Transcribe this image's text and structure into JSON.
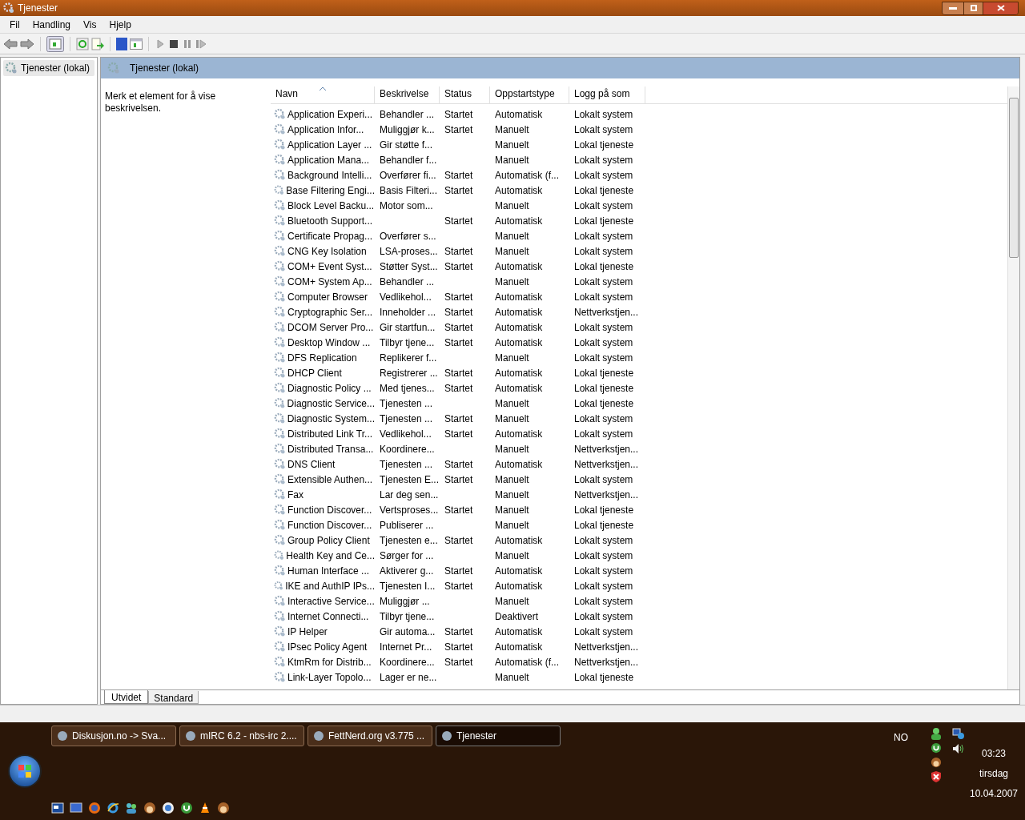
{
  "window": {
    "title": "Tjenester"
  },
  "menu": [
    "Fil",
    "Handling",
    "Vis",
    "Hjelp"
  ],
  "tree": [
    {
      "label": "Tjenester (lokal)",
      "selected": true
    }
  ],
  "header": {
    "title": "Tjenester (lokal)"
  },
  "description": "Merk et element for å vise beskrivelsen.",
  "table": {
    "columns": [
      {
        "label": "Navn",
        "sorted": true
      },
      {
        "label": "Beskrivelse",
        "sorted": false
      },
      {
        "label": "Status",
        "sorted": false
      },
      {
        "label": "Oppstartstype",
        "sorted": false
      },
      {
        "label": "Logg på som",
        "sorted": false
      }
    ],
    "rows": [
      {
        "name": "Application Experi...",
        "description": "Behandler ...",
        "status": "Startet",
        "startup": "Automatisk",
        "logon": "Lokalt system"
      },
      {
        "name": "Application Infor...",
        "description": "Muliggjør k...",
        "status": "Startet",
        "startup": "Manuelt",
        "logon": "Lokalt system"
      },
      {
        "name": "Application Layer ...",
        "description": "Gir støtte f...",
        "startup": "Manuelt",
        "logon": "Lokal tjeneste"
      },
      {
        "name": "Application Mana...",
        "description": "Behandler f...",
        "startup": "Manuelt",
        "logon": "Lokalt system"
      },
      {
        "name": "Background Intelli...",
        "description": "Overfører fi...",
        "status": "Startet",
        "startup": "Automatisk (f...",
        "logon": "Lokalt system"
      },
      {
        "name": "Base Filtering Engi...",
        "description": "Basis Filteri...",
        "status": "Startet",
        "startup": "Automatisk",
        "logon": "Lokal tjeneste"
      },
      {
        "name": "Block Level Backu...",
        "description": "Motor som...",
        "startup": "Manuelt",
        "logon": "Lokalt system"
      },
      {
        "name": "Bluetooth Support...",
        "status": "Startet",
        "startup": "Automatisk",
        "logon": "Lokal tjeneste"
      },
      {
        "name": "Certificate Propag...",
        "description": "Overfører s...",
        "startup": "Manuelt",
        "logon": "Lokalt system"
      },
      {
        "name": "CNG Key Isolation",
        "description": "LSA-proses...",
        "status": "Startet",
        "startup": "Manuelt",
        "logon": "Lokalt system"
      },
      {
        "name": "COM+ Event Syst...",
        "description": "Støtter Syst...",
        "status": "Startet",
        "startup": "Automatisk",
        "logon": "Lokal tjeneste"
      },
      {
        "name": "COM+ System Ap...",
        "description": "Behandler ...",
        "startup": "Manuelt",
        "logon": "Lokalt system"
      },
      {
        "name": "Computer Browser",
        "description": "Vedlikehol...",
        "status": "Startet",
        "startup": "Automatisk",
        "logon": "Lokalt system"
      },
      {
        "name": "Cryptographic Ser...",
        "description": "Inneholder ...",
        "status": "Startet",
        "startup": "Automatisk",
        "logon": "Nettverkstjen..."
      },
      {
        "name": "DCOM Server Pro...",
        "description": "Gir startfun...",
        "status": "Startet",
        "startup": "Automatisk",
        "logon": "Lokalt system"
      },
      {
        "name": "Desktop Window ...",
        "description": "Tilbyr tjene...",
        "status": "Startet",
        "startup": "Automatisk",
        "logon": "Lokalt system"
      },
      {
        "name": "DFS Replication",
        "description": "Replikerer f...",
        "startup": "Manuelt",
        "logon": "Lokalt system"
      },
      {
        "name": "DHCP Client",
        "description": "Registrerer ...",
        "status": "Startet",
        "startup": "Automatisk",
        "logon": "Lokal tjeneste"
      },
      {
        "name": "Diagnostic Policy ...",
        "description": "Med tjenes...",
        "status": "Startet",
        "startup": "Automatisk",
        "logon": "Lokal tjeneste"
      },
      {
        "name": "Diagnostic Service...",
        "description": "Tjenesten ...",
        "startup": "Manuelt",
        "logon": "Lokal tjeneste"
      },
      {
        "name": "Diagnostic System...",
        "description": "Tjenesten ...",
        "status": "Startet",
        "startup": "Manuelt",
        "logon": "Lokalt system"
      },
      {
        "name": "Distributed Link Tr...",
        "description": "Vedlikehol...",
        "status": "Startet",
        "startup": "Automatisk",
        "logon": "Lokalt system"
      },
      {
        "name": "Distributed Transa...",
        "description": "Koordinere...",
        "startup": "Manuelt",
        "logon": "Nettverkstjen..."
      },
      {
        "name": "DNS Client",
        "description": "Tjenesten ...",
        "status": "Startet",
        "startup": "Automatisk",
        "logon": "Nettverkstjen..."
      },
      {
        "name": "Extensible Authen...",
        "description": "Tjenesten E...",
        "status": "Startet",
        "startup": "Manuelt",
        "logon": "Lokalt system"
      },
      {
        "name": "Fax",
        "description": "Lar deg sen...",
        "startup": "Manuelt",
        "logon": "Nettverkstjen..."
      },
      {
        "name": "Function Discover...",
        "description": "Vertsproses...",
        "status": "Startet",
        "startup": "Manuelt",
        "logon": "Lokal tjeneste"
      },
      {
        "name": "Function Discover...",
        "description": "Publiserer ...",
        "startup": "Manuelt",
        "logon": "Lokal tjeneste"
      },
      {
        "name": "Group Policy Client",
        "description": "Tjenesten e...",
        "status": "Startet",
        "startup": "Automatisk",
        "logon": "Lokalt system"
      },
      {
        "name": "Health Key and Ce...",
        "description": "Sørger for ...",
        "startup": "Manuelt",
        "logon": "Lokalt system"
      },
      {
        "name": "Human Interface ...",
        "description": "Aktiverer g...",
        "status": "Startet",
        "startup": "Automatisk",
        "logon": "Lokalt system"
      },
      {
        "name": "IKE and AuthIP IPs...",
        "description": "Tjenesten I...",
        "status": "Startet",
        "startup": "Automatisk",
        "logon": "Lokalt system"
      },
      {
        "name": "Interactive Service...",
        "description": "Muliggjør ...",
        "startup": "Manuelt",
        "logon": "Lokalt system"
      },
      {
        "name": "Internet Connecti...",
        "description": "Tilbyr tjene...",
        "startup": "Deaktivert",
        "logon": "Lokalt system"
      },
      {
        "name": "IP Helper",
        "description": "Gir automa...",
        "status": "Startet",
        "startup": "Automatisk",
        "logon": "Lokalt system"
      },
      {
        "name": "IPsec Policy Agent",
        "description": "Internet Pr...",
        "status": "Startet",
        "startup": "Automatisk",
        "logon": "Nettverkstjen..."
      },
      {
        "name": "KtmRm for Distrib...",
        "description": "Koordinere...",
        "status": "Startet",
        "startup": "Automatisk (f...",
        "logon": "Nettverkstjen..."
      },
      {
        "name": "Link-Layer Topolo...",
        "description": "Lager er ne...",
        "startup": "Manuelt",
        "logon": "Lokal tjeneste"
      }
    ]
  },
  "view_tabs": [
    {
      "label": "Utvidet",
      "selected": true
    },
    {
      "label": "Standard",
      "selected": false
    }
  ],
  "taskbar": {
    "buttons": [
      {
        "label": "Diskusjon.no -> Sva...",
        "selected": false
      },
      {
        "label": "mIRC 6.2 - nbs-irc 2....",
        "selected": false
      },
      {
        "label": "FettNerd.org v3.775 ...",
        "selected": false
      },
      {
        "label": "Tjenester",
        "selected": true
      }
    ],
    "language": "NO",
    "time": "03:23",
    "day": "tirsdag",
    "date": "10.04.2007"
  }
}
